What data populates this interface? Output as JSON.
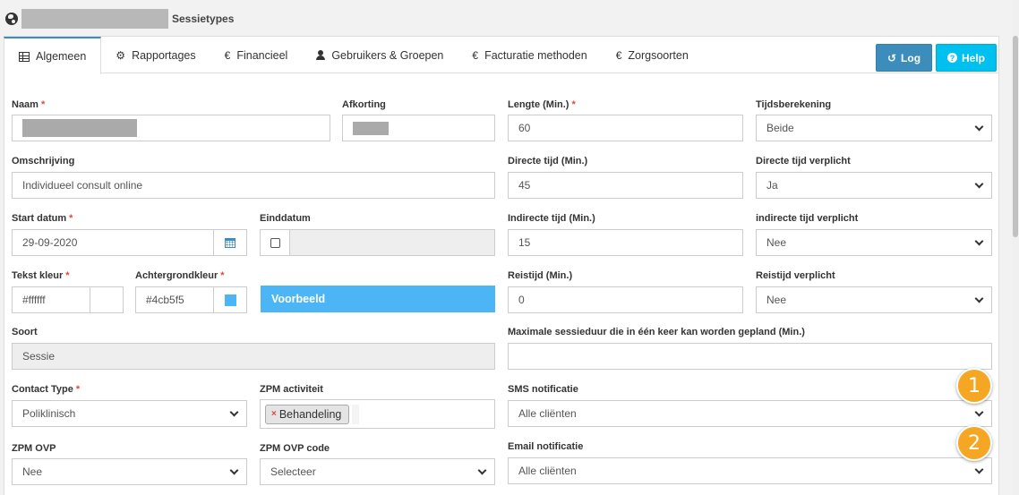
{
  "breadcrumb": {
    "page": "Sessietypes"
  },
  "tabs": [
    {
      "label": "Algemeen",
      "icon": "table-icon"
    },
    {
      "label": "Rapportages",
      "icon": "gear-icon"
    },
    {
      "label": "Financieel",
      "icon": "euro-icon"
    },
    {
      "label": "Gebruikers & Groepen",
      "icon": "user-icon"
    },
    {
      "label": "Facturatie methoden",
      "icon": "euro-icon"
    },
    {
      "label": "Zorgsoorten",
      "icon": "euro-icon"
    }
  ],
  "buttons": {
    "log": "Log",
    "help": "Help"
  },
  "form": {
    "naam": {
      "label": "Naam",
      "required": "*"
    },
    "afkorting": {
      "label": "Afkorting"
    },
    "lengte": {
      "label": "Lengte (Min.)",
      "required": "*",
      "value": "60"
    },
    "tijdsberekening": {
      "label": "Tijdsberekening",
      "value": "Beide"
    },
    "omschrijving": {
      "label": "Omschrijving",
      "value": "Individueel consult online"
    },
    "directe_tijd": {
      "label": "Directe tijd (Min.)",
      "value": "45"
    },
    "directe_tijd_verplicht": {
      "label": "Directe tijd verplicht",
      "value": "Ja"
    },
    "start_datum": {
      "label": "Start datum",
      "required": "*",
      "value": "29-09-2020"
    },
    "einddatum": {
      "label": "Einddatum"
    },
    "indirecte_tijd": {
      "label": "Indirecte tijd (Min.)",
      "value": "15"
    },
    "indirecte_tijd_verplicht": {
      "label": "indirecte tijd verplicht",
      "value": "Nee"
    },
    "tekst_kleur": {
      "label": "Tekst kleur",
      "required": "*",
      "value": "#ffffff"
    },
    "achtergrondkleur": {
      "label": "Achtergrondkleur",
      "required": "*",
      "value": "#4cb5f5"
    },
    "voorbeeld": {
      "label": "Voorbeeld"
    },
    "reistijd": {
      "label": "Reistijd (Min.)",
      "value": "0"
    },
    "reistijd_verplicht": {
      "label": "Reistijd verplicht",
      "value": "Nee"
    },
    "soort": {
      "label": "Soort",
      "value": "Sessie"
    },
    "max_sessieduur": {
      "label": "Maximale sessieduur die in één keer kan worden gepland (Min.)",
      "value": ""
    },
    "contact_type": {
      "label": "Contact Type",
      "required": "*",
      "value": "Poliklinisch"
    },
    "zpm_activiteit": {
      "label": "ZPM activiteit",
      "tag": "Behandeling",
      "tag_remove": "×"
    },
    "sms_notificatie": {
      "label": "SMS notificatie",
      "value": "Alle cliënten"
    },
    "zpm_ovp": {
      "label": "ZPM OVP",
      "value": "Nee"
    },
    "zpm_ovp_code": {
      "label": "ZPM OVP code",
      "value": "Selecteer"
    },
    "email_notificatie": {
      "label": "Email notificatie",
      "value": "Alle cliënten"
    }
  },
  "badges": {
    "one": "1",
    "two": "2"
  },
  "colors": {
    "primary": "#3c8dbc",
    "info": "#00c0ef",
    "preview_bg": "#4cb5f5",
    "badge": "#f5a623",
    "required": "#dd4b39"
  }
}
